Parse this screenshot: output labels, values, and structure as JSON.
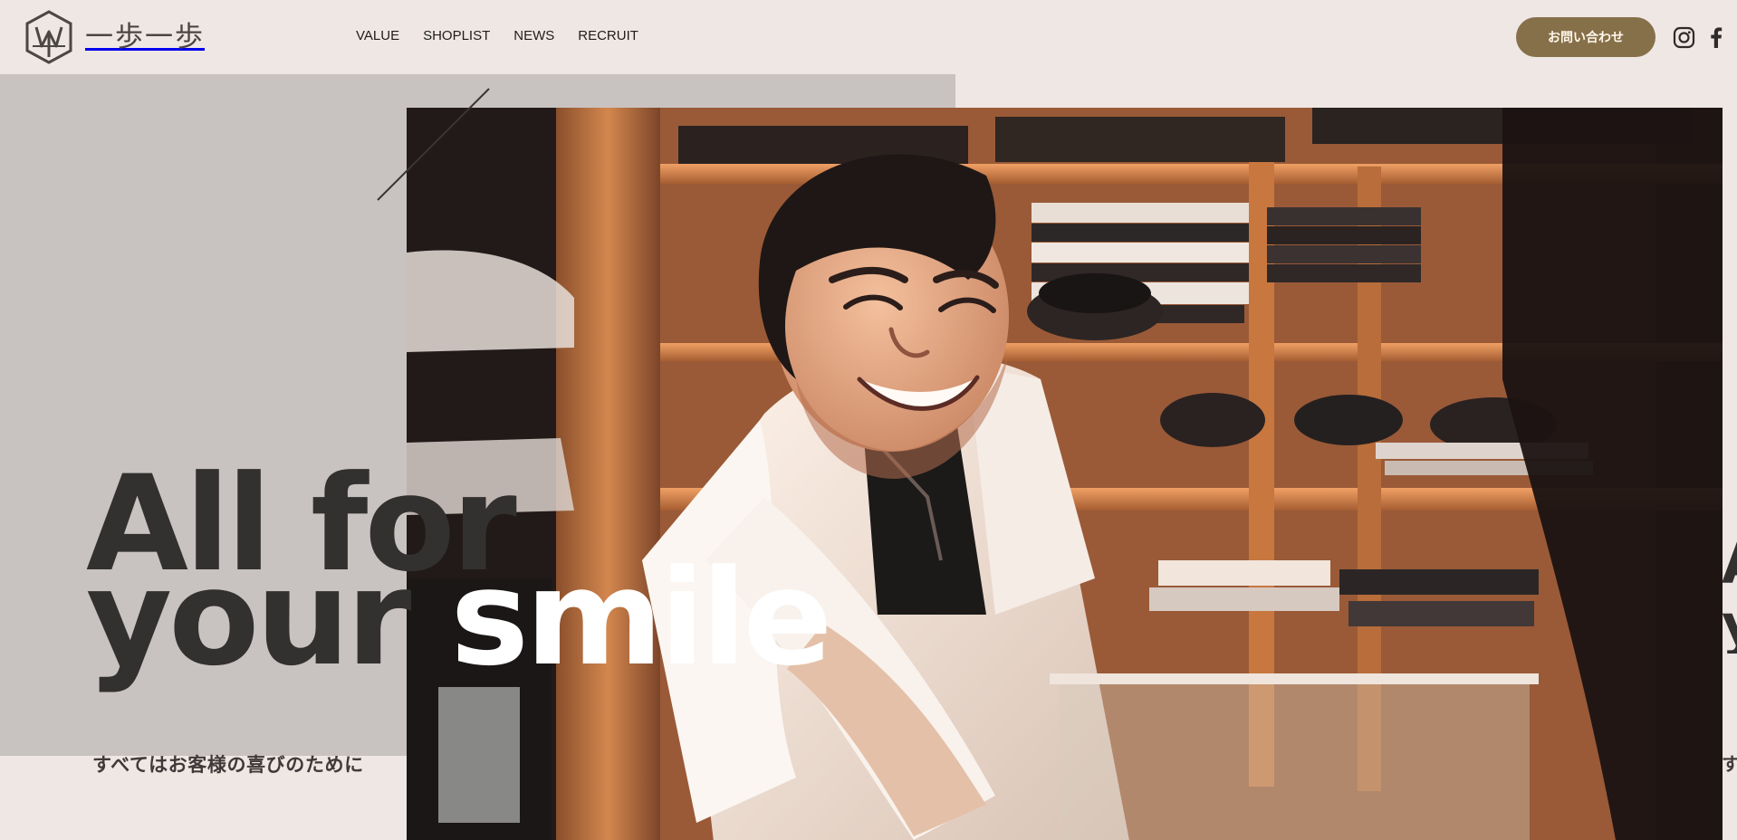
{
  "brand": {
    "name": "一歩一歩",
    "logo_icon": "hexagon-monogram-icon"
  },
  "nav": {
    "items": [
      {
        "label": "VALUE"
      },
      {
        "label": "SHOPLIST"
      },
      {
        "label": "NEWS"
      },
      {
        "label": "RECRUIT"
      }
    ]
  },
  "actions": {
    "contact_label": "お問い合わせ",
    "social": [
      {
        "icon": "instagram-icon"
      },
      {
        "icon": "facebook-icon"
      }
    ]
  },
  "hero": {
    "headline_line1": "All for",
    "headline_line2_prefix": "your ",
    "headline_line2_highlight": "smile",
    "subtitle": "すべてはお客様の喜びのために",
    "edge_letters": {
      "top": "A",
      "middle": "y",
      "bottom": "す"
    },
    "image_subject": "smiling chef in white kitchen coat at a wooden restaurant counter"
  },
  "colors": {
    "page_background": "#efe7e4",
    "hero_panel": "#c8c3c0",
    "button_brown": "#86704a",
    "headline_dark": "#333030",
    "headline_highlight": "#ffffff"
  }
}
